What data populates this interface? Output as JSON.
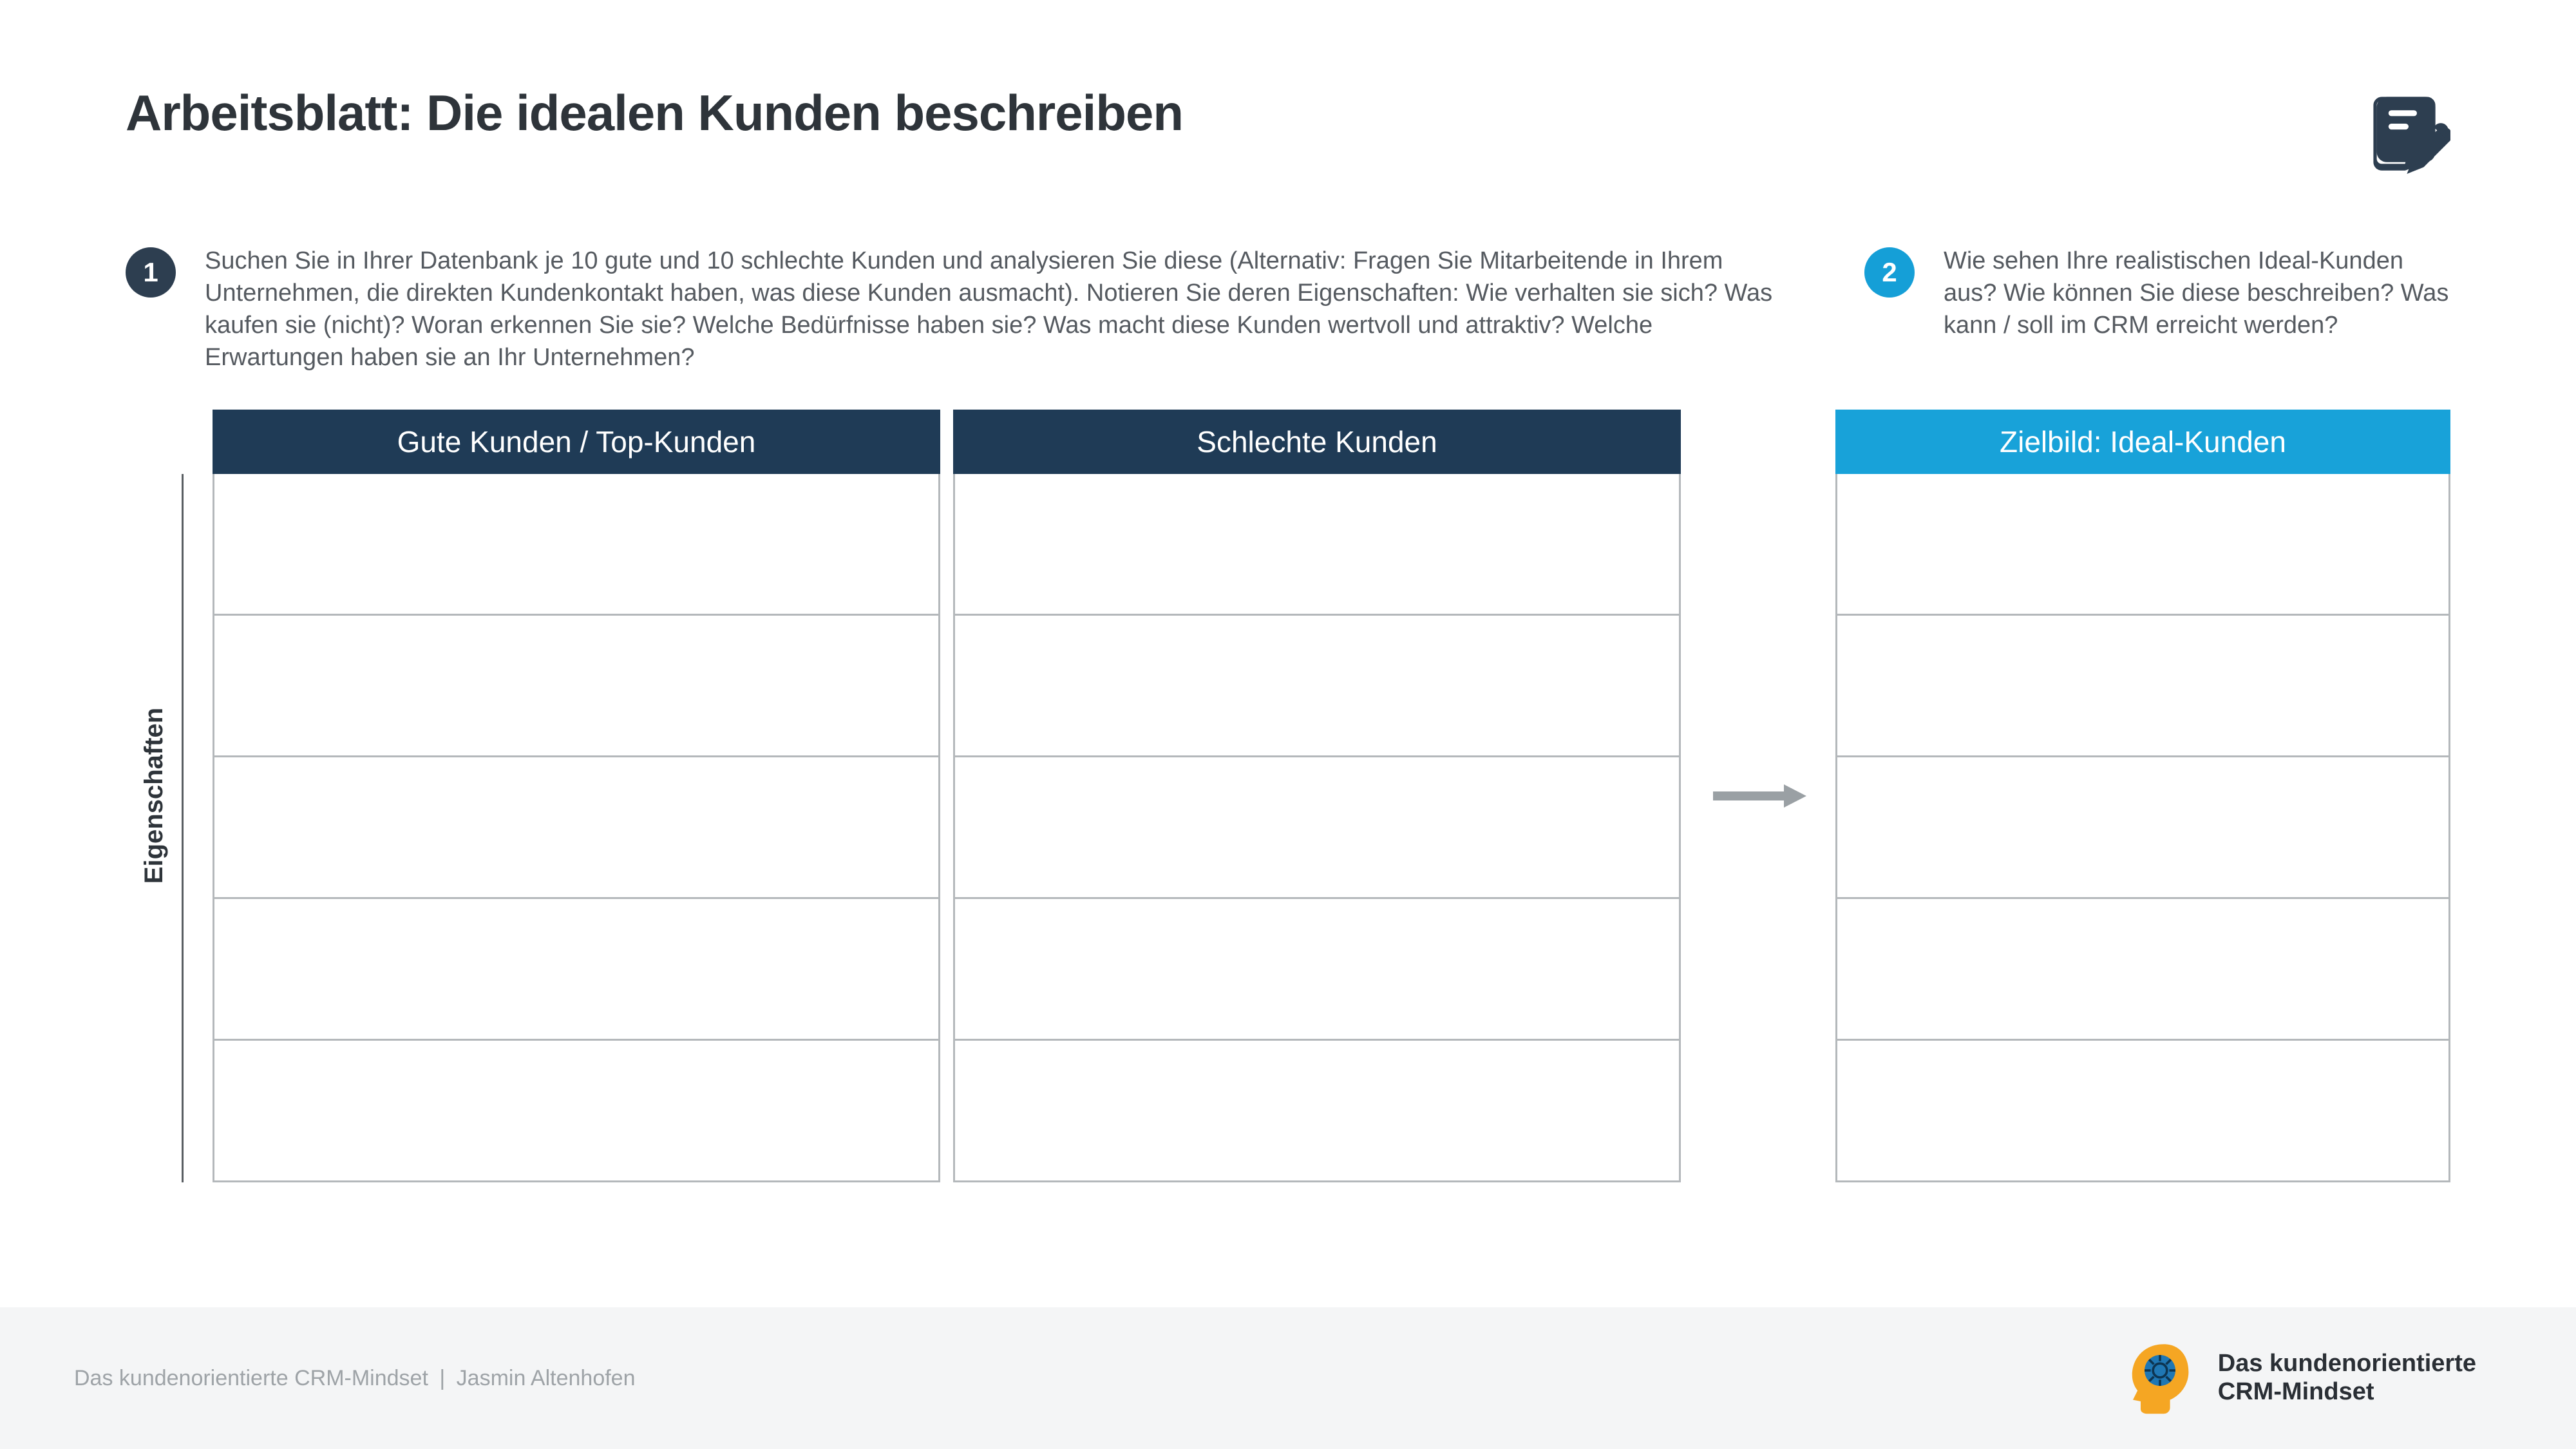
{
  "title": "Arbeitsblatt: Die idealen Kunden beschreiben",
  "steps": {
    "one": {
      "num": "1",
      "text": "Suchen Sie in Ihrer Datenbank je 10 gute und 10 schlechte Kunden und analysieren Sie diese (Alternativ: Fragen Sie Mitarbeitende in Ihrem Unternehmen, die direkten Kundenkontakt haben, was diese Kunden ausmacht). Notieren Sie deren Eigenschaften: Wie verhalten sie sich? Was kaufen sie (nicht)? Woran erkennen Sie sie? Welche Bedürfnisse haben sie? Was macht diese Kunden wertvoll und attraktiv? Welche Erwartungen haben sie an Ihr Unternehmen?"
    },
    "two": {
      "num": "2",
      "text": "Wie sehen Ihre realistischen Ideal-Kunden aus? Wie können Sie diese beschreiben? Was kann / soll im CRM erreicht werden?"
    }
  },
  "side_label": "Eigenschaften",
  "columns": {
    "good": "Gute Kunden / Top-Kunden",
    "bad": "Schlechte Kunden",
    "target": "Zielbild: Ideal-Kunden"
  },
  "row_count": 5,
  "footer": {
    "line1": "Das kundenorientierte CRM-Mindset",
    "line2": "Jasmin Altenhofen",
    "brand_line1": "Das kundenorientierte",
    "brand_line2": "CRM-Mindset"
  },
  "colors": {
    "dark": "#1f3b56",
    "blue": "#18a2d9",
    "badge_dark": "#2d3e50"
  }
}
